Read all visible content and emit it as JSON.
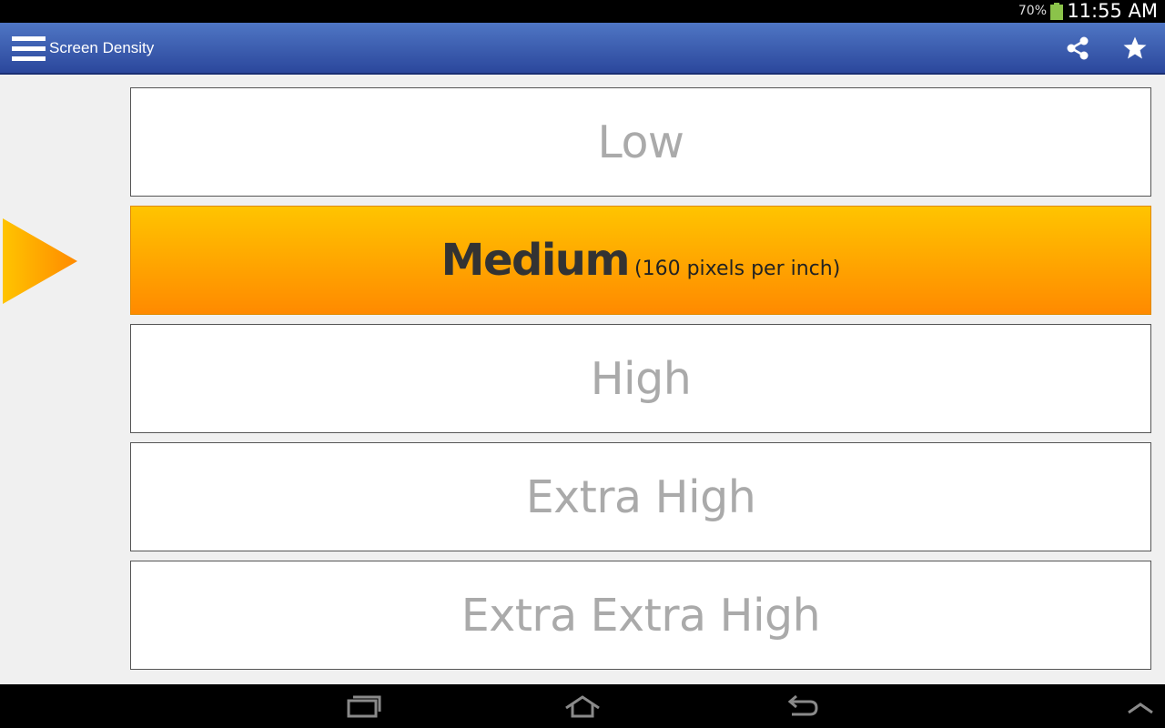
{
  "status_bar": {
    "battery_percent": "70%",
    "time": "11:55 AM"
  },
  "action_bar": {
    "title": "Screen Density",
    "icons": [
      "menu-icon",
      "share-icon",
      "star-icon"
    ]
  },
  "density_options": [
    {
      "label": "Low",
      "detail": "",
      "selected": false
    },
    {
      "label": "Medium",
      "detail": "(160  pixels per inch)",
      "selected": true
    },
    {
      "label": "High",
      "detail": "",
      "selected": false
    },
    {
      "label": "Extra High",
      "detail": "",
      "selected": false
    },
    {
      "label": "Extra Extra High",
      "detail": "",
      "selected": false
    }
  ],
  "nav_bar": {
    "icons": [
      "recent-apps-icon",
      "home-icon",
      "back-icon",
      "chevron-up-icon"
    ]
  },
  "colors": {
    "action_bar_top": "#4f76c4",
    "action_bar_bottom": "#2b479c",
    "selected_top": "#ffc400",
    "selected_bottom": "#ff8a00",
    "unselected_text": "#aaaaaa"
  }
}
